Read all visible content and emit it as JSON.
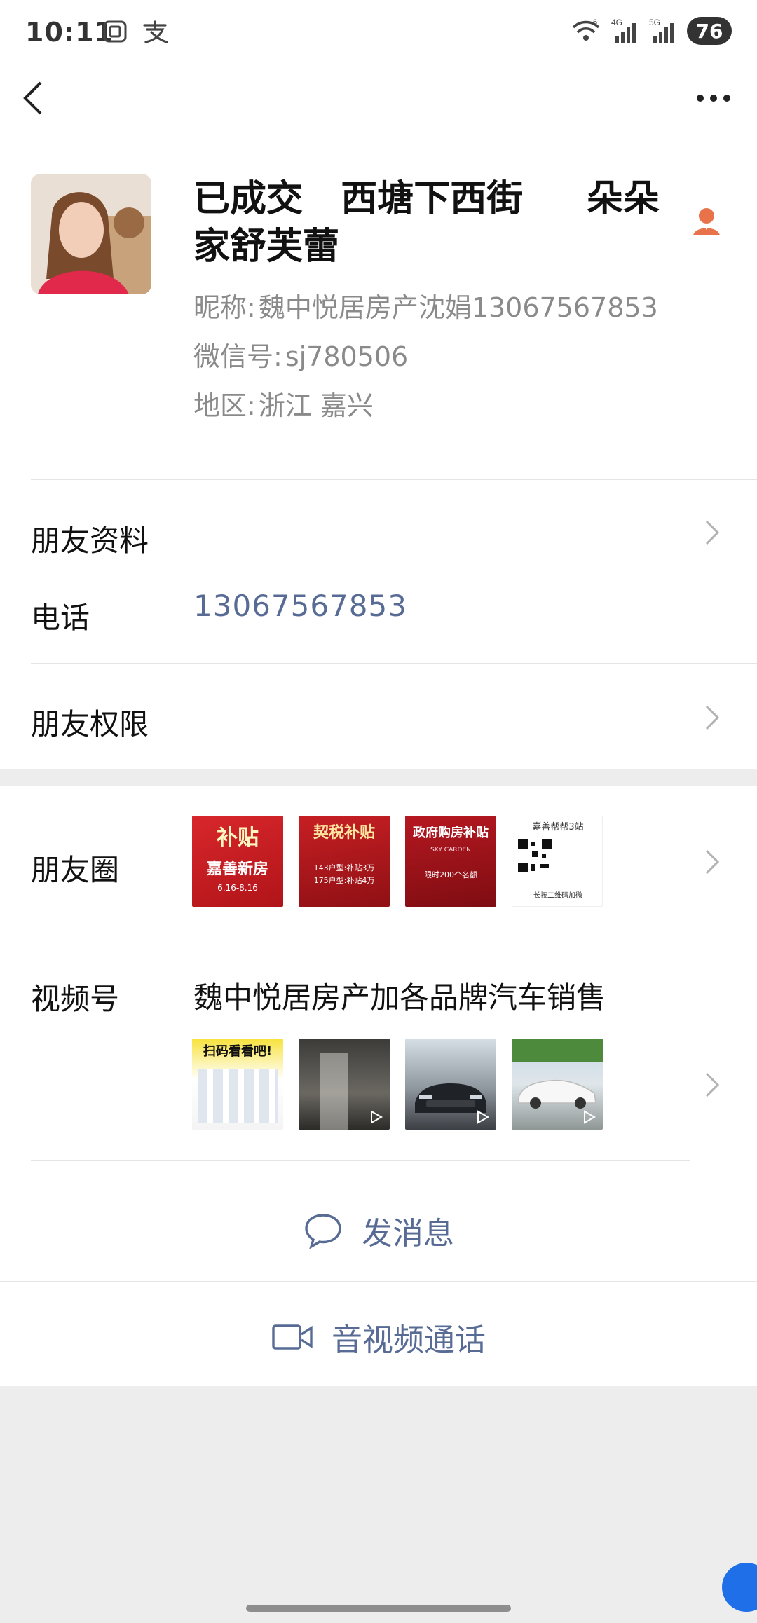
{
  "status_bar": {
    "time": "10:11",
    "network_labels": [
      "6",
      "4G",
      "5G"
    ],
    "battery": "76"
  },
  "profile": {
    "display_name": "已成交   西塘下西街     朵朵家舒芙蕾",
    "nickname_label": "昵称:",
    "nickname": "魏中悦居房产沈娟13067567853",
    "wechat_id_label": "微信号:",
    "wechat_id": "sj780506",
    "region_label": "地区:",
    "region": "浙江  嘉兴",
    "star_icon": "star-friend-icon"
  },
  "rows": {
    "friend_info": "朋友资料",
    "phone_label": "电话",
    "phone_value": "13067567853",
    "friend_permissions": "朋友权限",
    "moments": "朋友圈",
    "channels_label": "视频号",
    "channels_name": "魏中悦居房产加各品牌汽车销售"
  },
  "moments_thumbs": [
    {
      "headline": "补贴",
      "sub": "嘉善新房",
      "foot": "6.16-8.16"
    },
    {
      "headline": "契税补贴",
      "sub": "143户型:补贴3万",
      "foot": "175户型:补贴4万"
    },
    {
      "headline": "政府购房补贴",
      "sub": "SKY CARDEN",
      "foot": "限时200个名额"
    },
    {
      "headline": "嘉善帮帮3站",
      "sub": "长按二维码加微",
      "foot": ""
    }
  ],
  "channel_thumbs": [
    {
      "label": "扫码看看吧!",
      "video": false
    },
    {
      "label": "",
      "video": true
    },
    {
      "label": "",
      "video": true
    },
    {
      "label": "",
      "video": true
    }
  ],
  "actions": {
    "message": "发消息",
    "call": "音视频通话"
  },
  "colors": {
    "link": "#576b95",
    "star": "#e8734a",
    "background": "#ededed"
  }
}
